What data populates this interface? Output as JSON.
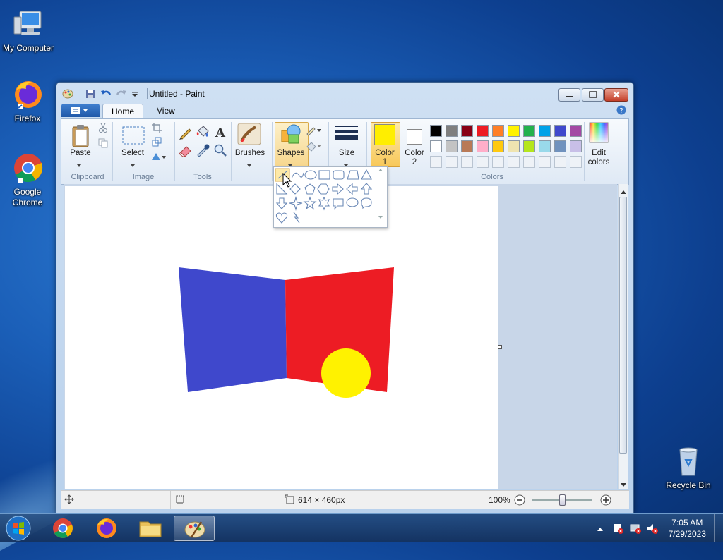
{
  "desktop": {
    "icons": [
      {
        "label": "My Computer",
        "icon": "computer-icon"
      },
      {
        "label": "Firefox",
        "icon": "firefox-icon"
      },
      {
        "label": "Google Chrome",
        "icon": "chrome-icon"
      },
      {
        "label": "Recycle Bin",
        "icon": "recycle-bin-icon"
      }
    ]
  },
  "window": {
    "title": "Untitled - Paint",
    "tabs": {
      "home": "Home",
      "view": "View"
    }
  },
  "ribbon": {
    "clipboard": {
      "paste": "Paste",
      "group": "Clipboard"
    },
    "image": {
      "select": "Select",
      "group": "Image"
    },
    "tools": {
      "group": "Tools"
    },
    "brushes": "Brushes",
    "shapes": "Shapes",
    "size": "Size",
    "color1": {
      "line1": "Color",
      "line2": "1",
      "value": "#ffee00"
    },
    "color2": {
      "line1": "Color",
      "line2": "2",
      "value": "#ffffff"
    },
    "colors_group": "Colors",
    "edit_colors": {
      "line1": "Edit",
      "line2": "colors"
    },
    "palette_row1": [
      "#000000",
      "#7f7f7f",
      "#880015",
      "#ed1c24",
      "#ff7f27",
      "#fff200",
      "#22b14c",
      "#00a2e8",
      "#3f48cc",
      "#a349a4"
    ],
    "palette_row2": [
      "#ffffff",
      "#c3c3c3",
      "#b97a57",
      "#ffaec9",
      "#ffc90e",
      "#efe4b0",
      "#b5e61d",
      "#99d9ea",
      "#7092be",
      "#c8bfe7"
    ]
  },
  "canvas": {
    "shapes": [
      {
        "kind": "quad",
        "color": "#3f48cc"
      },
      {
        "kind": "quad",
        "color": "#ed1c24"
      },
      {
        "kind": "circle",
        "color": "#fff200"
      }
    ]
  },
  "status": {
    "size": "614 × 460px",
    "zoom": "100%"
  },
  "taskbar": {
    "time": "7:05 AM",
    "date": "7/29/2023"
  }
}
